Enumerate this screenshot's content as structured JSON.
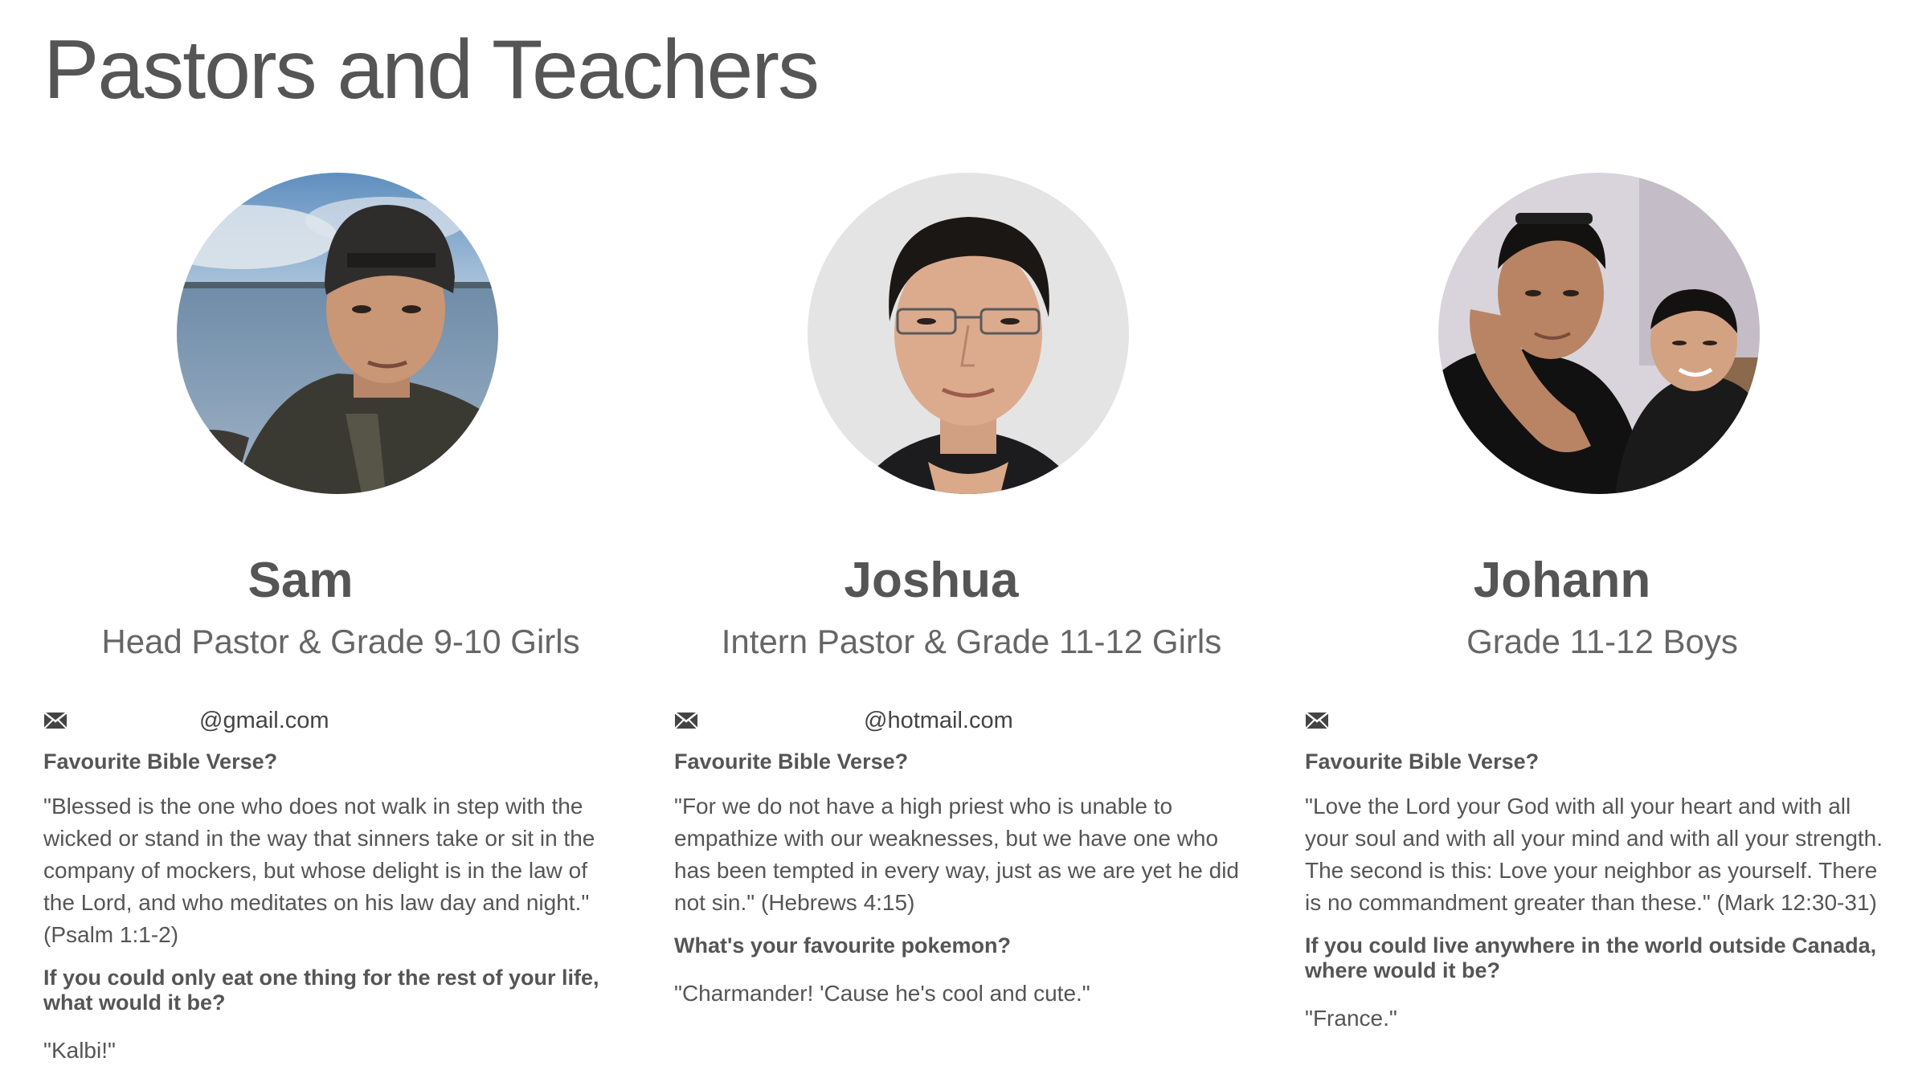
{
  "page": {
    "title": "Pastors and Teachers"
  },
  "colors": {
    "text": "#555555",
    "muted": "#666666"
  },
  "people": [
    {
      "name": "Sam",
      "role": "Head Pastor & Grade 9-10 Girls",
      "email": "@gmail.com",
      "q1": "Favourite Bible Verse?",
      "a1": "\"Blessed is the one who does not walk in step with the wicked or stand in the way that sinners take or sit in the company of mockers, but whose delight is in the law of the Lord, and who meditates on his law day and night.\" (Psalm 1:1-2)",
      "q2": "If you could only eat one thing for the rest of your life, what would it be?",
      "a2": "\"Kalbi!\""
    },
    {
      "name": "Joshua",
      "role": "Intern Pastor & Grade 11-12 Girls",
      "email": "@hotmail.com",
      "q1": "Favourite Bible Verse?",
      "a1": "\"For we do not have a high priest who is unable to empathize with our weaknesses, but we have one who has been tempted in every way, just as we are yet he did not sin.\" (Hebrews 4:15)",
      "q2": "What's your favourite pokemon?",
      "a2": "\"Charmander! 'Cause he's cool and cute.\""
    },
    {
      "name": "Johann",
      "role": "Grade 11-12 Boys",
      "email": "",
      "q1": "Favourite Bible Verse?",
      "a1": "\"Love the Lord your God with all your heart and with all your soul and with all your mind and with all your strength. The second is this: Love your neighbor as yourself. There is no commandment greater than these.\" (Mark 12:30-31)",
      "q2": "If you could live anywhere in the world outside Canada, where would it be?",
      "a2": "\"France.\""
    }
  ],
  "icons": {
    "email": "envelope-icon",
    "photo": "profile-photo"
  }
}
